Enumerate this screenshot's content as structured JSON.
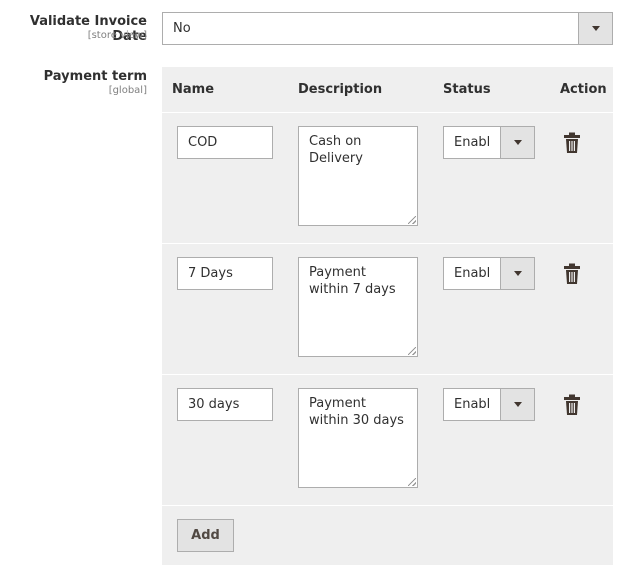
{
  "validate_invoice": {
    "label": "Validate Invoice Date",
    "scope": "[store view]",
    "value": "No"
  },
  "payment_term": {
    "label": "Payment term",
    "scope": "[global]",
    "columns": {
      "name": "Name",
      "description": "Description",
      "status": "Status",
      "action": "Action"
    },
    "rows": [
      {
        "name": "COD",
        "description": "Cash on Delivery",
        "status": "Enabl"
      },
      {
        "name": "7 Days",
        "description": "Payment within 7 days",
        "status": "Enabl"
      },
      {
        "name": "30 days",
        "description": "Payment within 30 days",
        "status": "Enabl"
      }
    ],
    "add_label": "Add"
  },
  "icons": {
    "dropdown": "chevron-down-icon",
    "delete": "trash-icon"
  },
  "colors": {
    "grid_bg": "#efefef",
    "border": "#adadad",
    "button_bg": "#e3e3e3",
    "icon": "#41362f"
  }
}
